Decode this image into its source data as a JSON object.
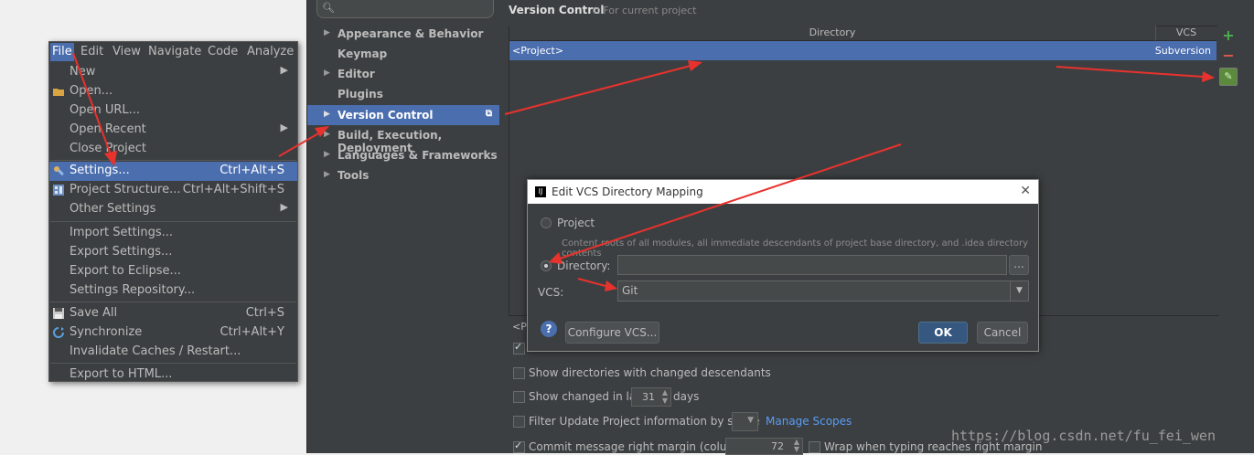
{
  "menubar": [
    "File",
    "Edit",
    "View",
    "Navigate",
    "Code",
    "Analyze"
  ],
  "file_menu": {
    "items": [
      {
        "label": "New",
        "shortcut": "",
        "submenu": true
      },
      {
        "label": "Open...",
        "shortcut": "",
        "submenu": false
      },
      {
        "label": "Open URL...",
        "shortcut": "",
        "submenu": false
      },
      {
        "label": "Open Recent",
        "shortcut": "",
        "submenu": true
      },
      {
        "label": "Close Project",
        "shortcut": "",
        "submenu": false
      },
      {
        "label": "Settings...",
        "shortcut": "Ctrl+Alt+S",
        "submenu": false
      },
      {
        "label": "Project Structure...",
        "shortcut": "Ctrl+Alt+Shift+S",
        "submenu": false
      },
      {
        "label": "Other Settings",
        "shortcut": "",
        "submenu": true
      },
      {
        "label": "Import Settings...",
        "shortcut": "",
        "submenu": false
      },
      {
        "label": "Export Settings...",
        "shortcut": "",
        "submenu": false
      },
      {
        "label": "Export to Eclipse...",
        "shortcut": "",
        "submenu": false
      },
      {
        "label": "Settings Repository...",
        "shortcut": "",
        "submenu": false
      },
      {
        "label": "Save All",
        "shortcut": "Ctrl+S",
        "submenu": false
      },
      {
        "label": "Synchronize",
        "shortcut": "Ctrl+Alt+Y",
        "submenu": false
      },
      {
        "label": "Invalidate Caches / Restart...",
        "shortcut": "",
        "submenu": false
      },
      {
        "label": "Export to HTML...",
        "shortcut": "",
        "submenu": false
      }
    ]
  },
  "settings_tree": [
    {
      "label": "Appearance & Behavior",
      "expandable": true
    },
    {
      "label": "Keymap",
      "expandable": false
    },
    {
      "label": "Editor",
      "expandable": true
    },
    {
      "label": "Plugins",
      "expandable": false
    },
    {
      "label": "Version Control",
      "expandable": true
    },
    {
      "label": "Build, Execution, Deployment",
      "expandable": true
    },
    {
      "label": "Languages & Frameworks",
      "expandable": true
    },
    {
      "label": "Tools",
      "expandable": true
    }
  ],
  "version_control": {
    "title": "Version Control",
    "subtitle": "For current project",
    "col_directory": "Directory",
    "col_vcs": "VCS",
    "row_directory": "<Project>",
    "row_vcs": "Subversion",
    "partial_text": "<Pr",
    "opt_changed_descendants": "Show directories with changed descendants",
    "opt_changed_in_last": "Show changed in last",
    "opt_changed_days_value": "31",
    "opt_days": "days",
    "opt_filter_update": "Filter Update Project information by scope",
    "manage_scopes": "Manage Scopes",
    "opt_commit_margin": "Commit message right margin (columns):",
    "commit_margin_value": "72",
    "opt_wrap": "Wrap when typing reaches right margin"
  },
  "dialog": {
    "title": "Edit VCS Directory Mapping",
    "project_label": "Project",
    "project_desc": "Content roots of all modules, all immediate descendants of project base directory, and .idea directory contents",
    "directory_label": "Directory:",
    "directory_value": "",
    "browse_label": "...",
    "vcs_label": "VCS:",
    "vcs_value": "Git",
    "configure_label": "Configure VCS...",
    "ok_label": "OK",
    "cancel_label": "Cancel",
    "help_label": "?"
  },
  "watermark": "https://blog.csdn.net/fu_fei_wen",
  "colors": {
    "selection": "#4b6eaf",
    "arrow": "#e8322d",
    "panel": "#3c3f41"
  }
}
